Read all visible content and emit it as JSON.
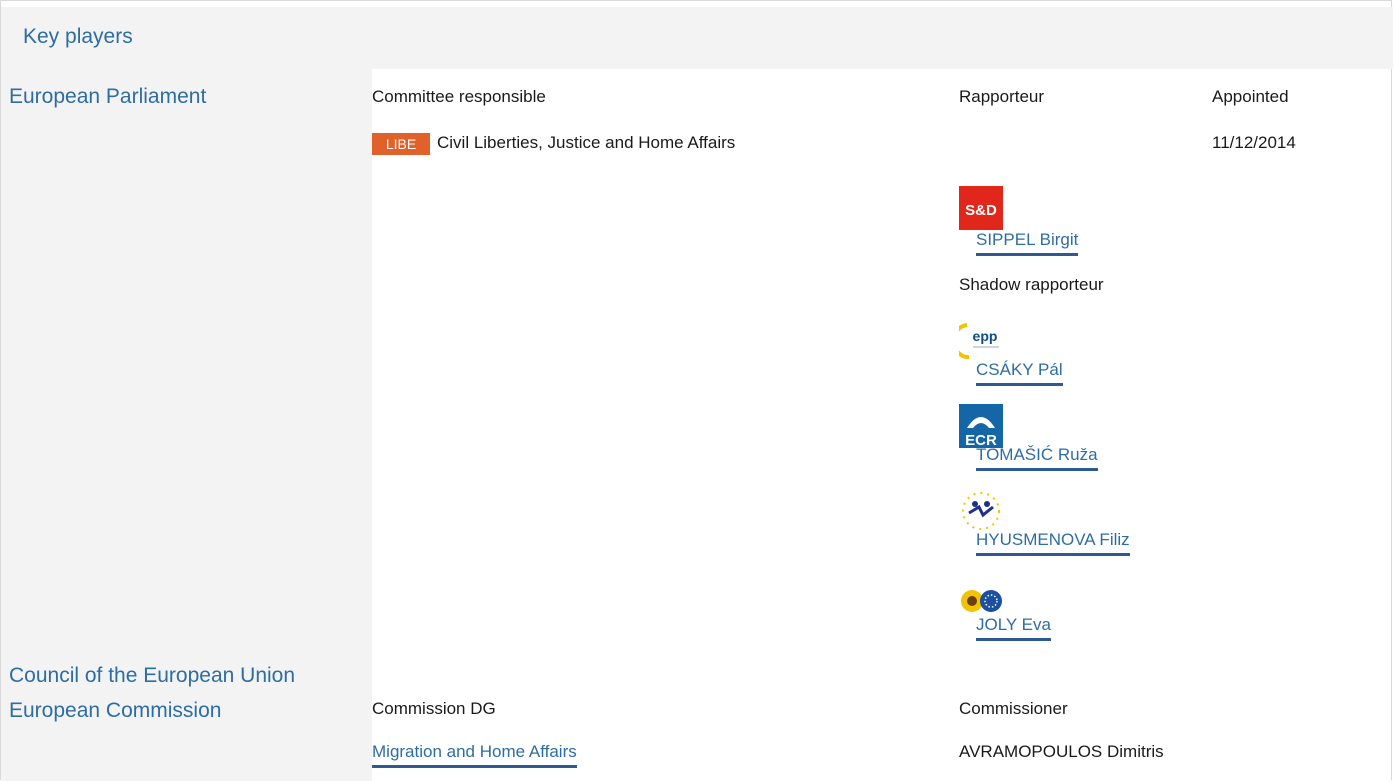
{
  "header": {
    "title": "Key players"
  },
  "institutions": {
    "parliament": "European Parliament",
    "council": "Council of the European Union",
    "commission": "European Commission"
  },
  "parliament": {
    "col_committee": "Committee responsible",
    "col_rapporteur": "Rapporteur",
    "col_appointed": "Appointed",
    "committee_badge": "LIBE",
    "committee_name": "Civil Liberties, Justice and Home Affairs",
    "appointed_date": "11/12/2014",
    "rapporteur": {
      "group_logo_text": "S&D",
      "name": "SIPPEL Birgit"
    },
    "shadow_label": "Shadow rapporteur",
    "shadows": [
      {
        "group_logo_text": "epp",
        "name": "CSÁKY Pál"
      },
      {
        "group_logo_text": "ECR",
        "name": "TOMAŠIĆ Ruža"
      },
      {
        "group_logo_text": "",
        "name": "HYUSMENOVA Filiz"
      },
      {
        "group_logo_text": "",
        "name": "JOLY Eva"
      }
    ]
  },
  "commission": {
    "col_dg": "Commission DG",
    "col_commissioner": "Commissioner",
    "dg_name": "Migration and Home Affairs",
    "commissioner_name": "AVRAMOPOULOS Dimitris"
  },
  "colors": {
    "link": "#2e6da4",
    "badge": "#e0622a",
    "panel": "#f3f3f3"
  }
}
